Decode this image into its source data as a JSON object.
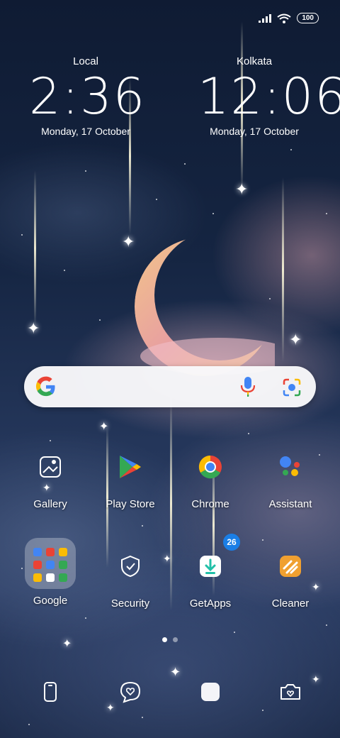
{
  "status_bar": {
    "battery": "100"
  },
  "clocks": [
    {
      "city": "Local",
      "time": "2:36",
      "date": "Monday, 17 October"
    },
    {
      "city": "Kolkata",
      "time": "12:06",
      "date": "Monday, 17 October"
    }
  ],
  "search": {
    "placeholder": ""
  },
  "apps_row1": [
    {
      "label": "Gallery",
      "icon": "gallery-icon"
    },
    {
      "label": "Play Store",
      "icon": "play-store-icon"
    },
    {
      "label": "Chrome",
      "icon": "chrome-icon"
    },
    {
      "label": "Assistant",
      "icon": "assistant-icon"
    }
  ],
  "apps_row2": [
    {
      "label": "Google",
      "icon": "google-folder-icon"
    },
    {
      "label": "Security",
      "icon": "security-icon"
    },
    {
      "label": "GetApps",
      "icon": "getapps-icon",
      "badge": "26"
    },
    {
      "label": "Cleaner",
      "icon": "cleaner-icon"
    }
  ],
  "dock": [
    {
      "icon": "phone-icon"
    },
    {
      "icon": "messages-icon"
    },
    {
      "icon": "browser-icon"
    },
    {
      "icon": "camera-icon"
    }
  ],
  "page_indicator": {
    "pages": 2,
    "active": 0
  },
  "colors": {
    "google_blue": "#4285F4",
    "google_red": "#EA4335",
    "google_yellow": "#FBBC05",
    "google_green": "#34A853",
    "badge_blue": "#1a7ee6"
  }
}
